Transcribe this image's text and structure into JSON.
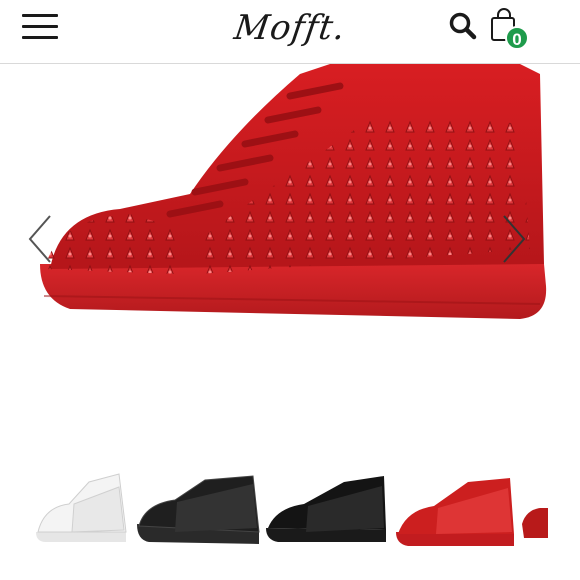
{
  "header": {
    "logo_text": "Mofft.",
    "cart_count": "0",
    "colors": {
      "badge": "#1e9b4b",
      "text": "#1a1a1a"
    }
  },
  "gallery": {
    "icons": {
      "prev": "chevron-left-icon",
      "next": "chevron-right-icon"
    },
    "thumbnails": [
      {
        "name": "white",
        "color": "#f2f2f2"
      },
      {
        "name": "black-leather",
        "color": "#1f1f1f"
      },
      {
        "name": "black-suede",
        "color": "#141414"
      },
      {
        "name": "red",
        "color": "#cc1f1f"
      },
      {
        "name": "red-partial",
        "color": "#b81a1a"
      }
    ]
  }
}
